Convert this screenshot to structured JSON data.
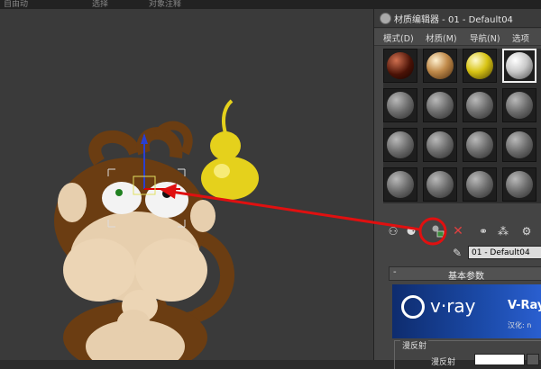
{
  "viewport": {
    "top_labels": [
      "自由动",
      "选择",
      "对象注释"
    ]
  },
  "material_editor": {
    "title": "材质编辑器 - 01 - Default04",
    "menu": [
      "模式(D)",
      "材质(M)",
      "导航(N)",
      "选项"
    ],
    "material_name": "01 - Default04",
    "rollout_title": "基本参数",
    "vray_logo": "v·ray",
    "vray_product": "V-Ray",
    "vray_localization": "汉化: n",
    "diffuse_group_label": "漫反射",
    "diffuse_label": "漫反射"
  },
  "colors": {
    "highlight_circle": "#e01010",
    "arrow": "#e01010",
    "slot_selected_border": "#f0f0f0",
    "vray_blue": "#1b4aa8"
  },
  "icons": [
    "delete-icon",
    "eyedropper-icon",
    "assign-material-icon"
  ]
}
